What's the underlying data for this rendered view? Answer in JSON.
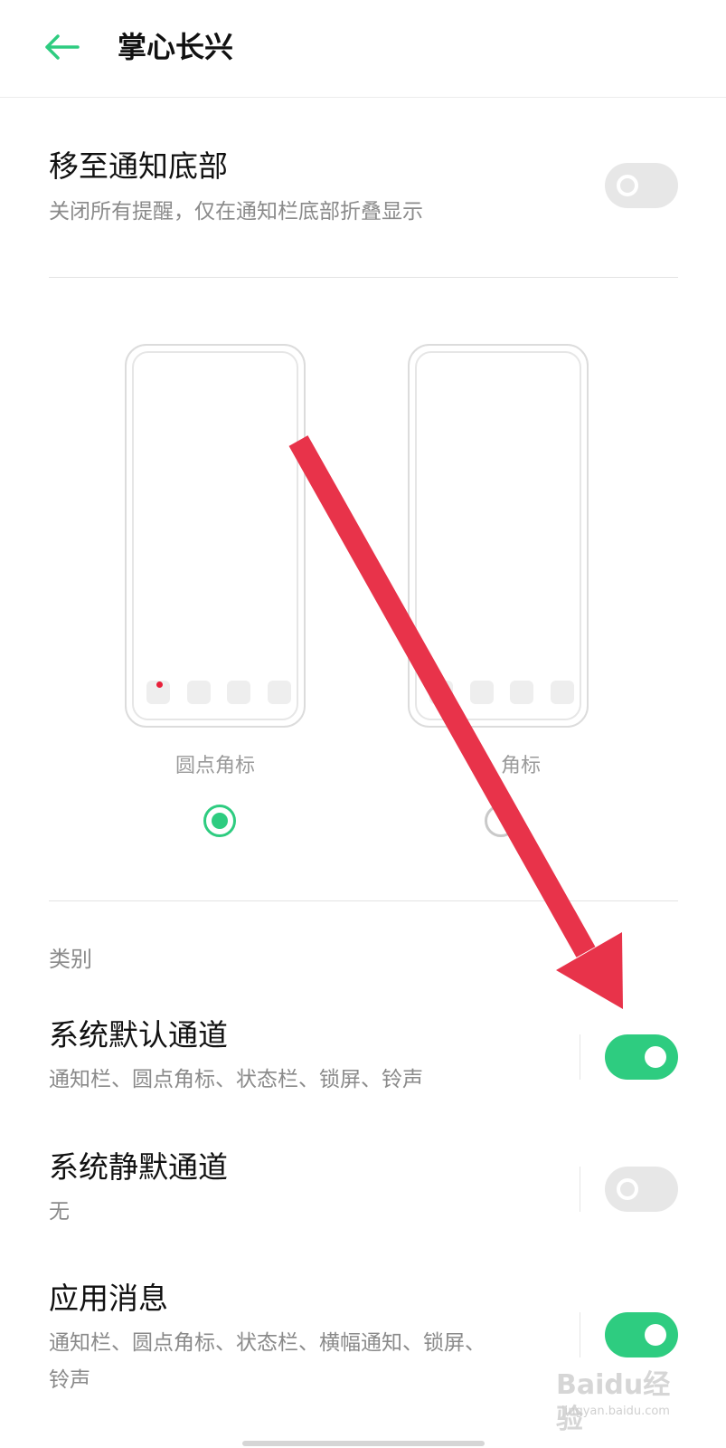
{
  "header": {
    "title": "掌心长兴"
  },
  "move_bottom": {
    "title": "移至通知底部",
    "subtitle": "关闭所有提醒，仅在通知栏底部折叠显示",
    "enabled": false
  },
  "badge_styles": [
    {
      "label": "圆点角标",
      "selected": true
    },
    {
      "label": "角标",
      "selected": false
    }
  ],
  "category": {
    "label": "类别",
    "channels": [
      {
        "title": "系统默认通道",
        "subtitle": "通知栏、圆点角标、状态栏、锁屏、铃声",
        "enabled": true
      },
      {
        "title": "系统静默通道",
        "subtitle": "无",
        "enabled": false
      },
      {
        "title": "应用消息",
        "subtitle": "通知栏、圆点角标、状态栏、横幅通知、锁屏、",
        "subtitle_line2": "铃声",
        "enabled": true
      }
    ]
  },
  "watermark": {
    "brand": "Baidu经验",
    "url": "jingyan.baidu.com"
  },
  "colors": {
    "accent_green": "#2ecc80",
    "back_arrow": "#2ecc80",
    "toggle_off": "#e7e7e7",
    "annotation_arrow": "#e8334a",
    "badge_dot": "#e8203a"
  },
  "icons": {
    "back": "arrow-left-icon"
  }
}
